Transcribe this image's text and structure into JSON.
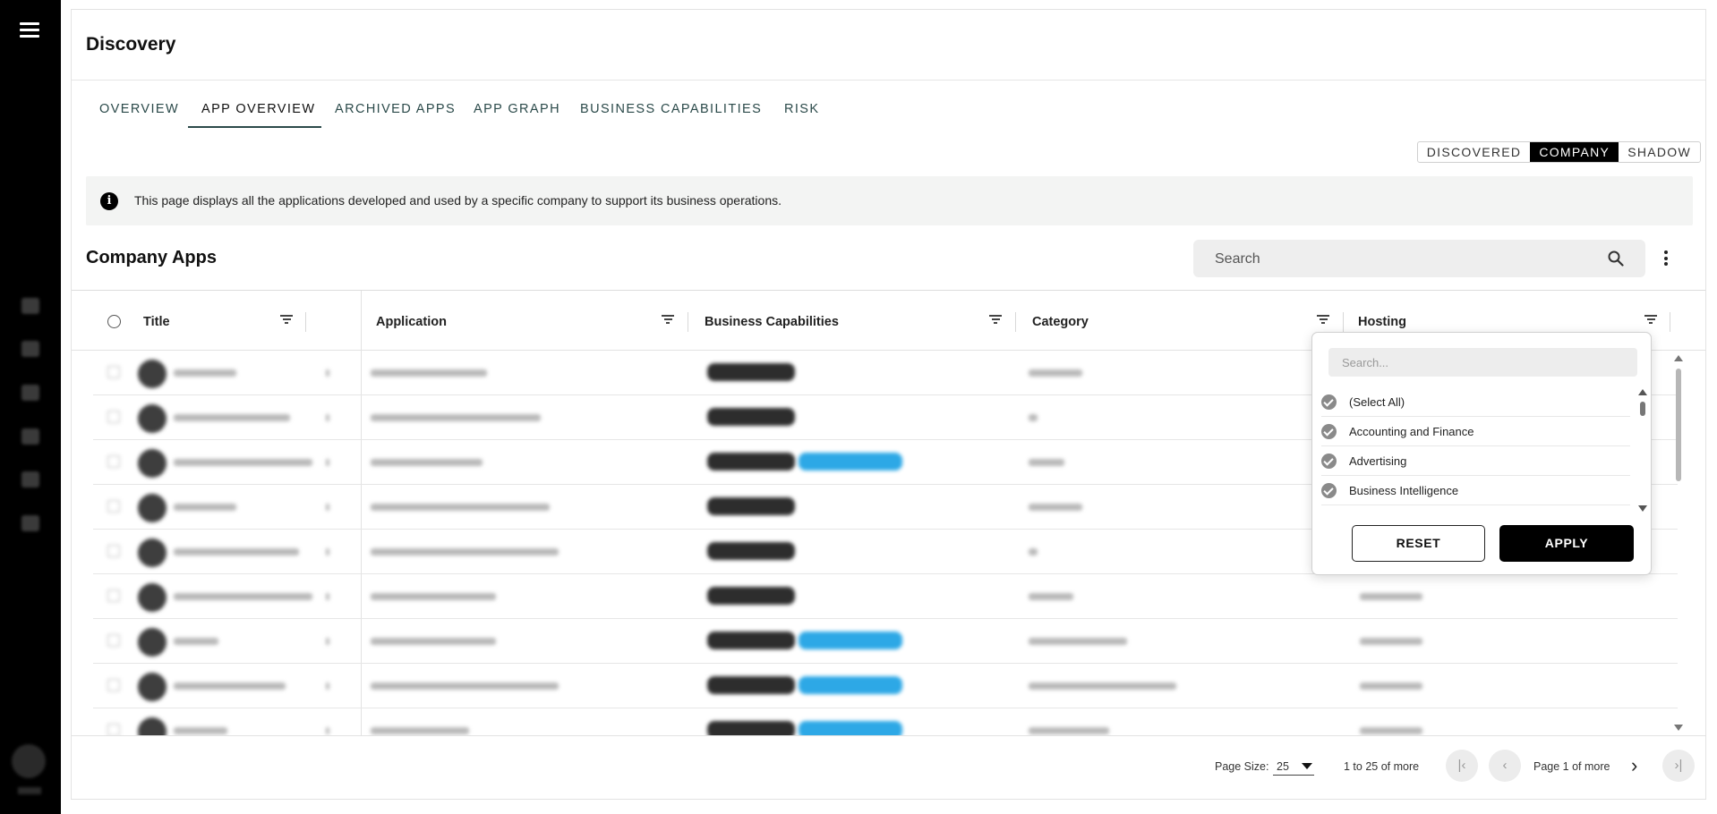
{
  "page": {
    "title": "Discovery"
  },
  "tabs": [
    {
      "label": "OVERVIEW",
      "active": false
    },
    {
      "label": "APP OVERVIEW",
      "active": true
    },
    {
      "label": "ARCHIVED APPS",
      "active": false
    },
    {
      "label": "APP GRAPH",
      "active": false
    },
    {
      "label": "BUSINESS CAPABILITIES",
      "active": false
    },
    {
      "label": "RISK",
      "active": false
    }
  ],
  "segment": {
    "options": [
      "DISCOVERED",
      "COMPANY",
      "SHADOW"
    ],
    "selected": "COMPANY"
  },
  "info": {
    "icon": "info-icon",
    "text": "This page displays all the applications developed and used by a specific company to support its business operations."
  },
  "section": {
    "title": "Company Apps"
  },
  "search": {
    "placeholder": "Search",
    "icon": "search-icon"
  },
  "grid": {
    "columns": [
      "Title",
      "Application",
      "Business Capabilities",
      "Category",
      "Hosting"
    ],
    "rows_note": "",
    "row_count_visible": 9
  },
  "filter_popup": {
    "column": "Category",
    "search_placeholder": "Search...",
    "options": [
      {
        "label": "(Select All)",
        "checked": true
      },
      {
        "label": "Accounting and Finance",
        "checked": true
      },
      {
        "label": "Advertising",
        "checked": true
      },
      {
        "label": "Business Intelligence",
        "checked": true
      }
    ],
    "reset_label": "RESET",
    "apply_label": "APPLY"
  },
  "footer": {
    "page_size_label": "Page Size:",
    "page_size_value": "25",
    "range_text": "1 to 25 of more",
    "page_text": "Page 1 of more"
  },
  "colors": {
    "sidebar": "#000000",
    "accent_tab": "#2b4a4a",
    "tag_dark": "#2d2d2d",
    "tag_blue": "#2da8e6"
  }
}
